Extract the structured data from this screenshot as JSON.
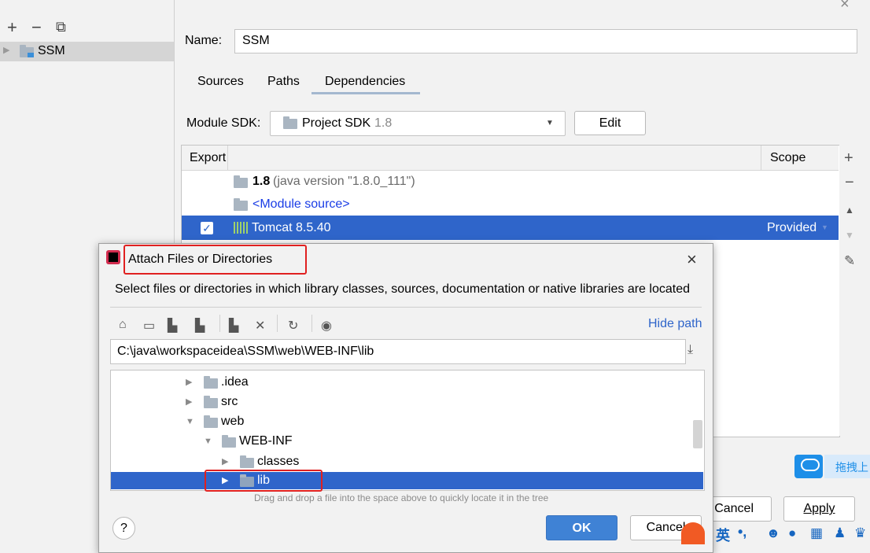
{
  "left_panel": {
    "toolbar": {
      "add": "+",
      "remove": "−",
      "copy": "⧉"
    },
    "tree_item": "SSM"
  },
  "module": {
    "name_label": "Name:",
    "name_value": "SSM",
    "tabs": [
      {
        "label": "Sources"
      },
      {
        "label": "Paths"
      },
      {
        "label": "Dependencies",
        "active": true
      }
    ],
    "sdk_label": "Module SDK:",
    "sdk_value": "Project SDK",
    "sdk_version": "1.8",
    "edit_button": "Edit",
    "table": {
      "col_export": "Export",
      "col_scope": "Scope",
      "rows": [
        {
          "name": "1.8",
          "detail": "(java version \"1.8.0_111\")"
        },
        {
          "name": "<Module source>"
        },
        {
          "name": "Tomcat 8.5.40",
          "checked": true,
          "scope": "Provided",
          "selected": true
        }
      ]
    },
    "cancel_button": "Cancel",
    "apply_button": "Apply"
  },
  "dialog": {
    "title": "Attach Files or Directories",
    "description": "Select files or directories in which library classes, sources, documentation or native libraries are located",
    "hide_path": "Hide path",
    "path": "C:\\java\\workspaceidea\\SSM\\web\\WEB-INF\\lib",
    "tree": [
      {
        "label": ".idea",
        "level": 0
      },
      {
        "label": "src",
        "level": 0
      },
      {
        "label": "web",
        "level": 0,
        "expanded": true
      },
      {
        "label": "WEB-INF",
        "level": 1,
        "expanded": true
      },
      {
        "label": "classes",
        "level": 2
      },
      {
        "label": "lib",
        "level": 2,
        "selected": true
      }
    ],
    "hint": "Drag and drop a file into the space above to quickly locate it in the tree",
    "help": "?",
    "ok_button": "OK",
    "cancel_button": "Cancel"
  },
  "overlay": {
    "cloud_text": "拖拽上",
    "ime_lang": "英"
  },
  "colors": {
    "selection": "#2f65ca",
    "link": "#2f65ca",
    "highlight": "#e02020",
    "module_source": "#1a3de6"
  }
}
